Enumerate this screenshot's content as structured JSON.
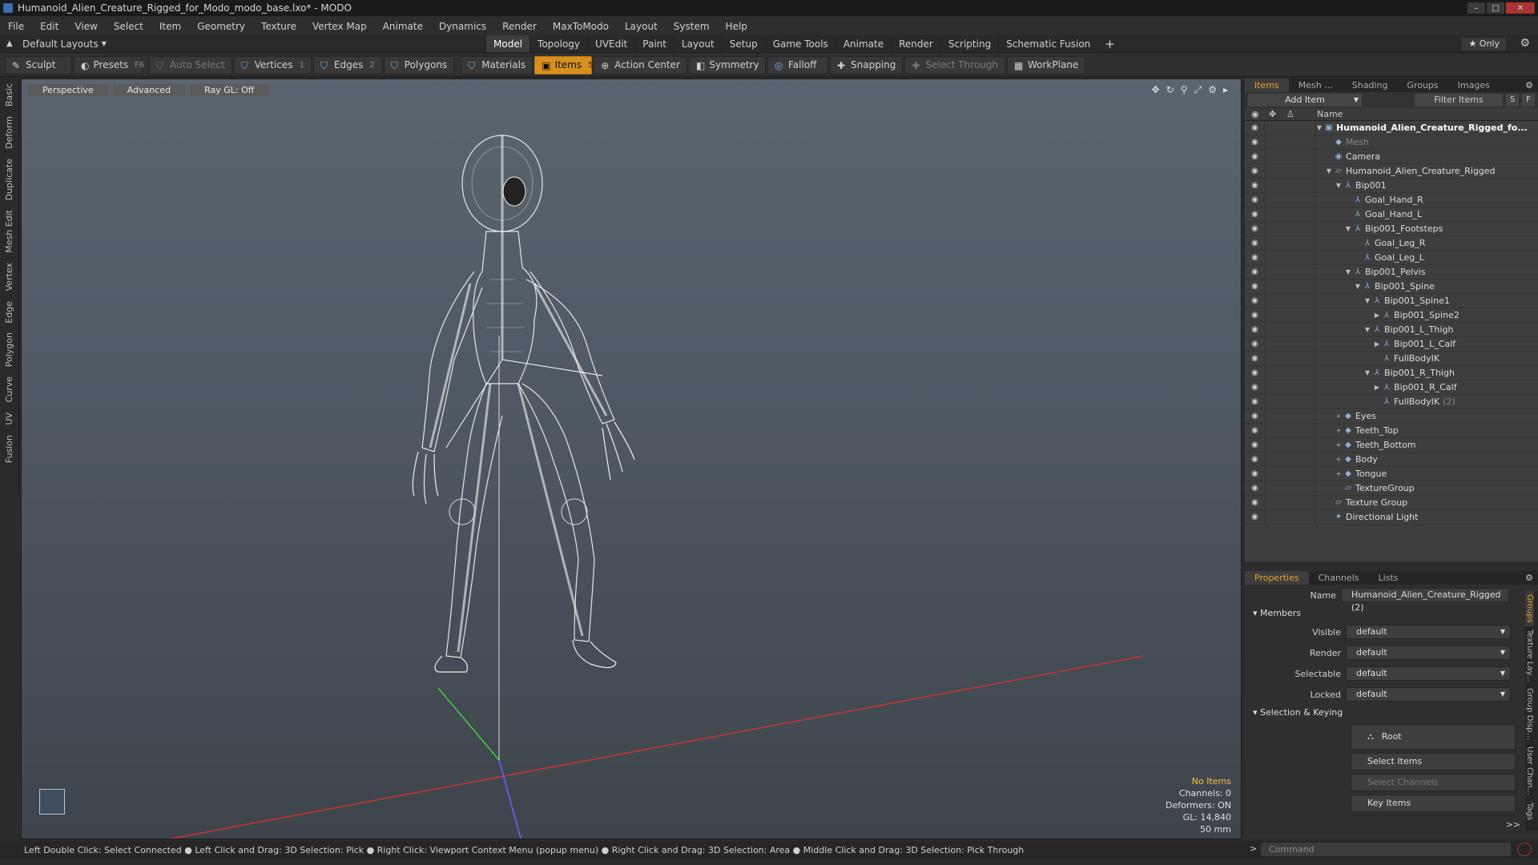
{
  "window": {
    "title": "Humanoid_Alien_Creature_Rigged_for_Modo_modo_base.lxo* - MODO",
    "buttons": [
      "–",
      "□",
      "✕"
    ]
  },
  "menu": [
    "File",
    "Edit",
    "View",
    "Select",
    "Item",
    "Geometry",
    "Texture",
    "Vertex Map",
    "Animate",
    "Dynamics",
    "Render",
    "MaxToModo",
    "Layout",
    "System",
    "Help"
  ],
  "layoutbar": {
    "layouts_label": "Default Layouts",
    "tabs": [
      "Model",
      "Topology",
      "UVEdit",
      "Paint",
      "Layout",
      "Setup",
      "Game Tools",
      "Animate",
      "Render",
      "Scripting",
      "Schematic Fusion"
    ],
    "active_tab": "Model",
    "plus": "+",
    "only": "★  Only"
  },
  "toolbar": {
    "sculpt": "Sculpt",
    "presets": "Presets",
    "presets_key": "F6",
    "auto_select": "Auto Select",
    "vertices": "Vertices",
    "vertices_key": "1",
    "edges": "Edges",
    "edges_key": "2",
    "polygons": "Polygons",
    "materials": "Materials",
    "items": "Items",
    "items_key": "5",
    "action_center": "Action Center",
    "symmetry": "Symmetry",
    "falloff": "Falloff",
    "snapping": "Snapping",
    "select_through": "Select Through",
    "workplane": "WorkPlane"
  },
  "sidetabs": [
    "Basic",
    "Deform",
    "Duplicate",
    "Mesh Edit",
    "Vertex",
    "Edge",
    "Polygon",
    "Curve",
    "UV",
    "Fusion"
  ],
  "viewport": {
    "view": "Perspective",
    "shading": "Advanced",
    "raygl": "Ray GL: Off",
    "info": {
      "no_items": "No Items",
      "channels": "Channels: 0",
      "deformers": "Deformers: ON",
      "gl": "GL: 14,840",
      "focal": "50 mm"
    }
  },
  "status": {
    "hint": "Left Double Click: Select Connected ● Left Click and Drag: 3D Selection: Pick ● Right Click: Viewport Context Menu (popup menu) ● Right Click and Drag: 3D Selection: Area ● Middle Click and Drag: 3D Selection: Pick Through",
    "command_placeholder": "Command",
    "command_arrow": ">"
  },
  "items_panel": {
    "tabs": [
      "Items",
      "Mesh ...",
      "Shading",
      "Groups",
      "Images"
    ],
    "add_item": "Add Item",
    "filter": "Filter Items",
    "s": "S",
    "f": "F",
    "name_col": "Name",
    "tree": [
      {
        "name": "Humanoid_Alien_Creature_Rigged_fo...",
        "depth": 0,
        "arrow": "▼",
        "icon": "▣",
        "bold": true
      },
      {
        "name": "Mesh",
        "depth": 1,
        "arrow": "",
        "icon": "◆",
        "dim": true
      },
      {
        "name": "Camera",
        "depth": 1,
        "arrow": "",
        "icon": "◉"
      },
      {
        "name": "Humanoid_Alien_Creature_Rigged",
        "depth": 1,
        "arrow": "▼",
        "icon": "▱"
      },
      {
        "name": "Bip001",
        "depth": 2,
        "arrow": "▼",
        "icon": "⅄"
      },
      {
        "name": "Goal_Hand_R",
        "depth": 3,
        "arrow": "",
        "icon": "⅄"
      },
      {
        "name": "Goal_Hand_L",
        "depth": 3,
        "arrow": "",
        "icon": "⅄"
      },
      {
        "name": "Bip001_Footsteps",
        "depth": 3,
        "arrow": "▼",
        "icon": "⅄"
      },
      {
        "name": "Goal_Leg_R",
        "depth": 4,
        "arrow": "",
        "icon": "⅄"
      },
      {
        "name": "Goal_Leg_L",
        "depth": 4,
        "arrow": "",
        "icon": "⅄"
      },
      {
        "name": "Bip001_Pelvis",
        "depth": 3,
        "arrow": "▼",
        "icon": "⅄"
      },
      {
        "name": "Bip001_Spine",
        "depth": 4,
        "arrow": "▼",
        "icon": "⅄"
      },
      {
        "name": "Bip001_Spine1",
        "depth": 5,
        "arrow": "▼",
        "icon": "⅄"
      },
      {
        "name": "Bip001_Spine2",
        "depth": 6,
        "arrow": "▶",
        "icon": "⅄"
      },
      {
        "name": "Bip001_L_Thigh",
        "depth": 5,
        "arrow": "▼",
        "icon": "⅄"
      },
      {
        "name": "Bip001_L_Calf",
        "depth": 6,
        "arrow": "▶",
        "icon": "⅄"
      },
      {
        "name": "FullBodyIK",
        "depth": 6,
        "arrow": "",
        "icon": "⅄"
      },
      {
        "name": "Bip001_R_Thigh",
        "depth": 5,
        "arrow": "▼",
        "icon": "⅄"
      },
      {
        "name": "Bip001_R_Calf",
        "depth": 6,
        "arrow": "▶",
        "icon": "⅄"
      },
      {
        "name": "FullBodyIK",
        "depth": 6,
        "arrow": "",
        "icon": "⅄",
        "count": "(2)"
      },
      {
        "name": "Eyes",
        "depth": 2,
        "arrow": "+",
        "icon": "◆"
      },
      {
        "name": "Teeth_Top",
        "depth": 2,
        "arrow": "+",
        "icon": "◆"
      },
      {
        "name": "Teeth_Bottom",
        "depth": 2,
        "arrow": "+",
        "icon": "◆"
      },
      {
        "name": "Body",
        "depth": 2,
        "arrow": "+",
        "icon": "◆"
      },
      {
        "name": "Tongue",
        "depth": 2,
        "arrow": "+",
        "icon": "◆"
      },
      {
        "name": "TextureGroup",
        "depth": 2,
        "arrow": "",
        "icon": "▱"
      },
      {
        "name": "Texture Group",
        "depth": 1,
        "arrow": "",
        "icon": "▱"
      },
      {
        "name": "Directional Light",
        "depth": 1,
        "arrow": "",
        "icon": "✦"
      }
    ]
  },
  "properties": {
    "tabs": [
      "Properties",
      "Channels",
      "Lists"
    ],
    "name_label": "Name",
    "name_value": "Humanoid_Alien_Creature_Rigged (2)",
    "members": "Members",
    "fields": [
      {
        "label": "Visible",
        "value": "default"
      },
      {
        "label": "Render",
        "value": "default"
      },
      {
        "label": "Selectable",
        "value": "default"
      },
      {
        "label": "Locked",
        "value": "default"
      }
    ],
    "selection_keying": "Selection & Keying",
    "root": "Root",
    "select_items": "Select Items",
    "select_channels": "Select Channels",
    "key_items": "Key Items",
    "more": ">>",
    "vtabs": [
      "Groups",
      "Texture Lay...",
      "Group Disp...",
      "User Chan...",
      "Tags"
    ]
  },
  "colors": {
    "accent": "#e8a32e",
    "items_active": "#d7901f",
    "viewport_top": "#5a6570",
    "viewport_bottom": "#3d444b"
  }
}
